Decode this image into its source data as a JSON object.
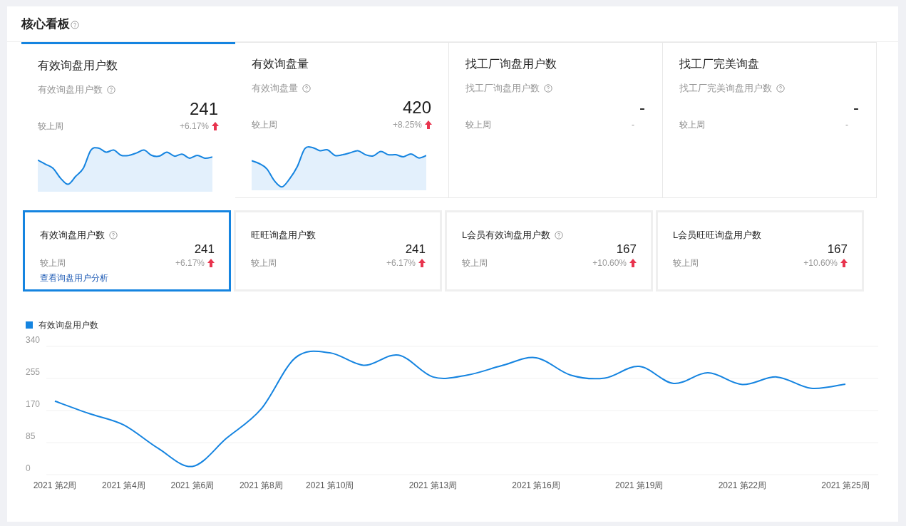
{
  "board": {
    "title": "核心看板",
    "help": true
  },
  "top_cards": [
    {
      "selected": true,
      "title": "有效询盘用户数",
      "subtitle": "有效询盘用户数",
      "help": true,
      "value": "241",
      "compare_label": "较上周",
      "change": "+6.17%",
      "rising": true,
      "kind": "sparkline"
    },
    {
      "selected": false,
      "title": "有效询盘量",
      "subtitle": "有效询盘量",
      "help": true,
      "value": "420",
      "compare_label": "较上周",
      "change": "+8.25%",
      "rising": true,
      "kind": "sparkline"
    },
    {
      "selected": false,
      "title": "找工厂询盘用户数",
      "subtitle": "找工厂询盘用户数",
      "help": true,
      "value": "-",
      "compare_label": "较上周",
      "change": "-",
      "rising": false,
      "kind": "empty"
    },
    {
      "selected": false,
      "title": "找工厂完美询盘",
      "subtitle": "找工厂完美询盘用户数",
      "help": true,
      "value": "-",
      "compare_label": "较上周",
      "change": "-",
      "rising": false,
      "kind": "empty"
    }
  ],
  "metric_cards": [
    {
      "selected": true,
      "title": "有效询盘用户数",
      "help": true,
      "value": "241",
      "compare_label": "较上周",
      "change": "+6.17%",
      "rising": true,
      "link": "查看询盘用户分析"
    },
    {
      "selected": false,
      "title": "旺旺询盘用户数",
      "help": false,
      "value": "241",
      "compare_label": "较上周",
      "change": "+6.17%",
      "rising": true
    },
    {
      "selected": false,
      "title": "L会员有效询盘用户数",
      "help": true,
      "value": "167",
      "compare_label": "较上周",
      "change": "+10.60%",
      "rising": true
    },
    {
      "selected": false,
      "title": "L会员旺旺询盘用户数",
      "help": false,
      "value": "167",
      "compare_label": "较上周",
      "change": "+10.60%",
      "rising": true
    }
  ],
  "chart_data": {
    "type": "line",
    "categories": [
      "2021 第2周",
      null,
      "2021 第4周",
      null,
      "2021 第6周",
      null,
      "2021 第8周",
      null,
      "2021 第10周",
      null,
      null,
      "2021 第13周",
      null,
      null,
      "2021 第16周",
      null,
      null,
      "2021 第19周",
      null,
      null,
      "2021 第22周",
      null,
      null,
      "2021 第25周"
    ],
    "series": [
      {
        "name": "有效询盘用户数",
        "color": "#1584e0",
        "values": [
          195,
          162,
          132,
          70,
          22,
          97,
          174,
          310,
          323,
          290,
          317,
          259,
          264,
          289,
          310,
          264,
          256,
          287,
          242,
          270,
          239,
          259,
          229,
          240
        ]
      }
    ],
    "ylim": [
      0,
      340
    ],
    "yticks": [
      0,
      85,
      170,
      255,
      340
    ],
    "grid": true
  }
}
